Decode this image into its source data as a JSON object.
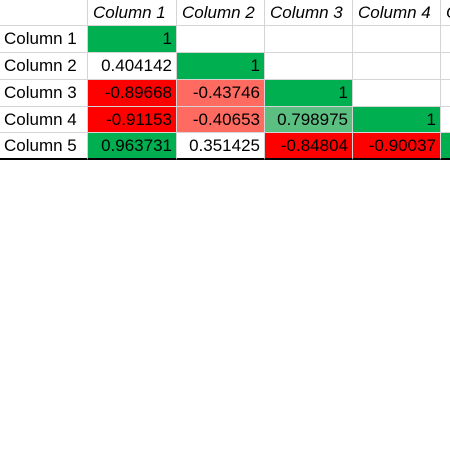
{
  "sheet": {
    "column_headers": [
      "Column 1",
      "Column 2",
      "Column 3",
      "Column 4",
      "C"
    ],
    "rows": [
      {
        "label": "Column 1",
        "cells": [
          {
            "value": "1",
            "color": "#00b050"
          },
          {
            "value": "",
            "color": "#ffffff"
          },
          {
            "value": "",
            "color": "#ffffff"
          },
          {
            "value": "",
            "color": "#ffffff"
          },
          {
            "value": "",
            "color": "#ffffff"
          }
        ]
      },
      {
        "label": "Column 2",
        "cells": [
          {
            "value": "0.404142",
            "color": "#ffffff"
          },
          {
            "value": "1",
            "color": "#00b050"
          },
          {
            "value": "",
            "color": "#ffffff"
          },
          {
            "value": "",
            "color": "#ffffff"
          },
          {
            "value": "",
            "color": "#ffffff"
          }
        ]
      },
      {
        "label": "Column 3",
        "cells": [
          {
            "value": "-0.89668",
            "color": "#ff0000"
          },
          {
            "value": "-0.43746",
            "color": "#ff6b61"
          },
          {
            "value": "1",
            "color": "#00b050"
          },
          {
            "value": "",
            "color": "#ffffff"
          },
          {
            "value": "",
            "color": "#ffffff"
          }
        ]
      },
      {
        "label": "Column 4",
        "cells": [
          {
            "value": "-0.91153",
            "color": "#ff0000"
          },
          {
            "value": "-0.40653",
            "color": "#ff6b61"
          },
          {
            "value": "0.798975",
            "color": "#5cbf82"
          },
          {
            "value": "1",
            "color": "#00b050"
          },
          {
            "value": "",
            "color": "#ffffff"
          }
        ]
      },
      {
        "label": "Column 5",
        "cells": [
          {
            "value": "0.963731",
            "color": "#00b050"
          },
          {
            "value": "0.351425",
            "color": "#ffffff"
          },
          {
            "value": "-0.84804",
            "color": "#ff0000"
          },
          {
            "value": "-0.90037",
            "color": "#ff0000"
          },
          {
            "value": "",
            "color": "#00b050"
          }
        ]
      }
    ]
  }
}
